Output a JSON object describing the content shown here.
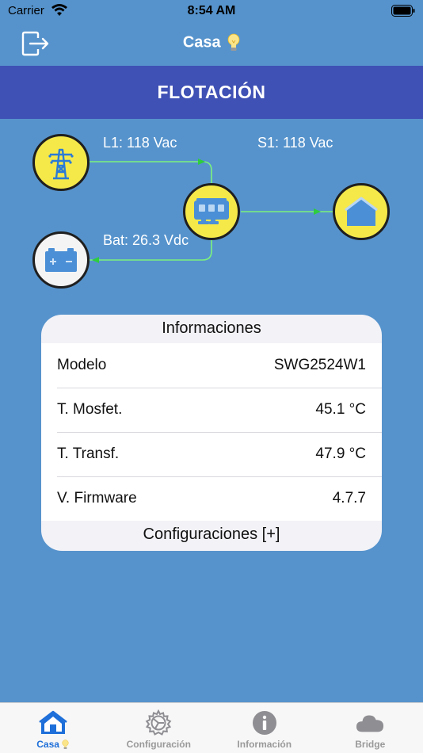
{
  "status_bar": {
    "carrier": "Carrier",
    "time": "8:54 AM"
  },
  "nav": {
    "title": "Casa",
    "icon": "lightbulb-icon",
    "logout_icon": "logout-icon"
  },
  "state": {
    "label": "FLOTACIÓN"
  },
  "flow": {
    "grid_label": "L1: 118 Vac",
    "output_label": "S1: 118 Vac",
    "battery_label": "Bat: 26.3 Vdc",
    "line_color": "#7cf27c",
    "arrow_color": "#2ecc40"
  },
  "info_card": {
    "title": "Informaciones",
    "rows": [
      {
        "label": "Modelo",
        "value": "SWG2524W1"
      },
      {
        "label": "T. Mosfet.",
        "value": "45.1 °C"
      },
      {
        "label": "T. Transf.",
        "value": "47.9 °C"
      },
      {
        "label": "V. Firmware",
        "value": "4.7.7"
      }
    ],
    "footer": "Configuraciones [+]"
  },
  "tabs": [
    {
      "label": "Casa",
      "icon": "house-icon",
      "active": true
    },
    {
      "label": "Configuración",
      "icon": "gear-icon",
      "active": false
    },
    {
      "label": "Información",
      "icon": "info-icon",
      "active": false
    },
    {
      "label": "Bridge",
      "icon": "cloud-icon",
      "active": false
    }
  ],
  "colors": {
    "background": "#5693cc",
    "banner": "#3f51b5",
    "node_fill": "#f5e94a",
    "active_tab": "#1e6fd9"
  }
}
